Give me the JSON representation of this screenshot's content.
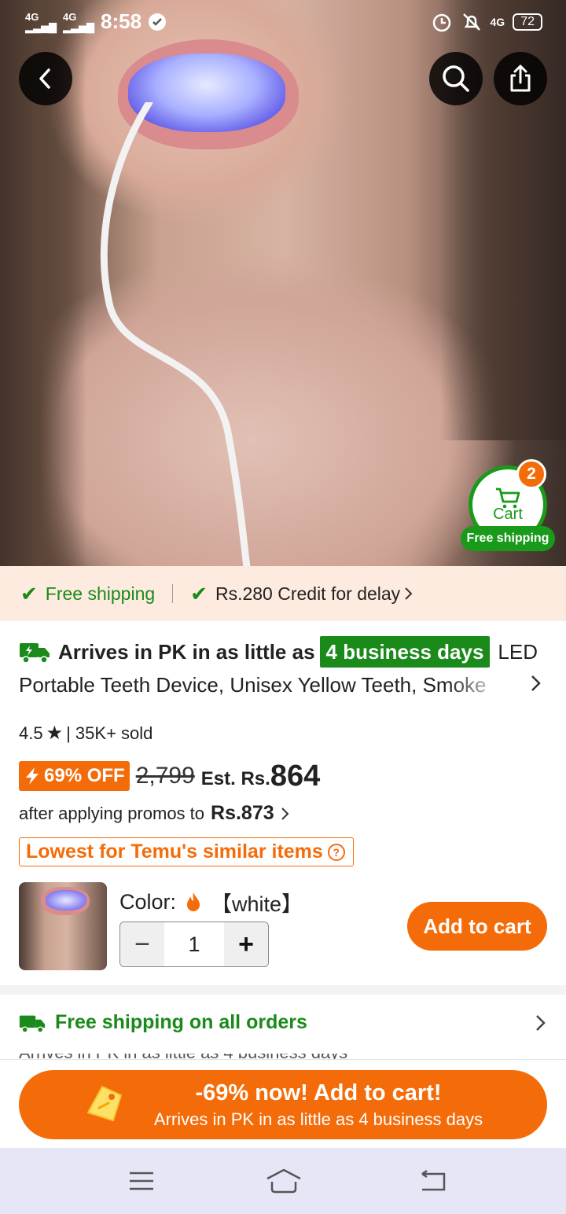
{
  "status_bar": {
    "signal1": "4G",
    "signal2": "4G",
    "time": "8:58",
    "net": "4G",
    "battery": "72"
  },
  "header": {
    "back_icon": "back-arrow-icon",
    "search_icon": "search-icon",
    "share_icon": "share-icon"
  },
  "cart_float": {
    "badge": "2",
    "label": "Cart",
    "shipping": "Free shipping"
  },
  "promo_strip": {
    "free_shipping": "Free shipping",
    "credit": "Rs.280 Credit for delay"
  },
  "product": {
    "arrives_prefix": "Arrives in PK in as little as",
    "arrives_days": "4 business days",
    "title_suffix": "LED",
    "title_line2": "Portable Teeth Device, Unisex Yellow Teeth, Smoke",
    "rating": "4.5",
    "sold": "| 35K+ sold",
    "discount": "69% OFF",
    "old_price": "2,799",
    "est_label": "Est. Rs.",
    "price": "864",
    "promo_text": "after applying promos to",
    "promo_price": "Rs.873",
    "lowest_label": "Lowest for Temu's similar items",
    "color_label": "Color:",
    "color_value": "【white】",
    "quantity": "1",
    "add_to_cart": "Add to cart"
  },
  "shipping_section": {
    "label": "Free shipping on all orders",
    "next_line": "Arrives in PK in as little as 4 business days"
  },
  "cta": {
    "line1": "-69% now! Add to cart!",
    "line2": "Arrives in PK in as little as 4 business days"
  },
  "colors": {
    "accent_orange": "#f46c0a",
    "green": "#1a8a1a",
    "strip_bg": "#fdebe0"
  }
}
